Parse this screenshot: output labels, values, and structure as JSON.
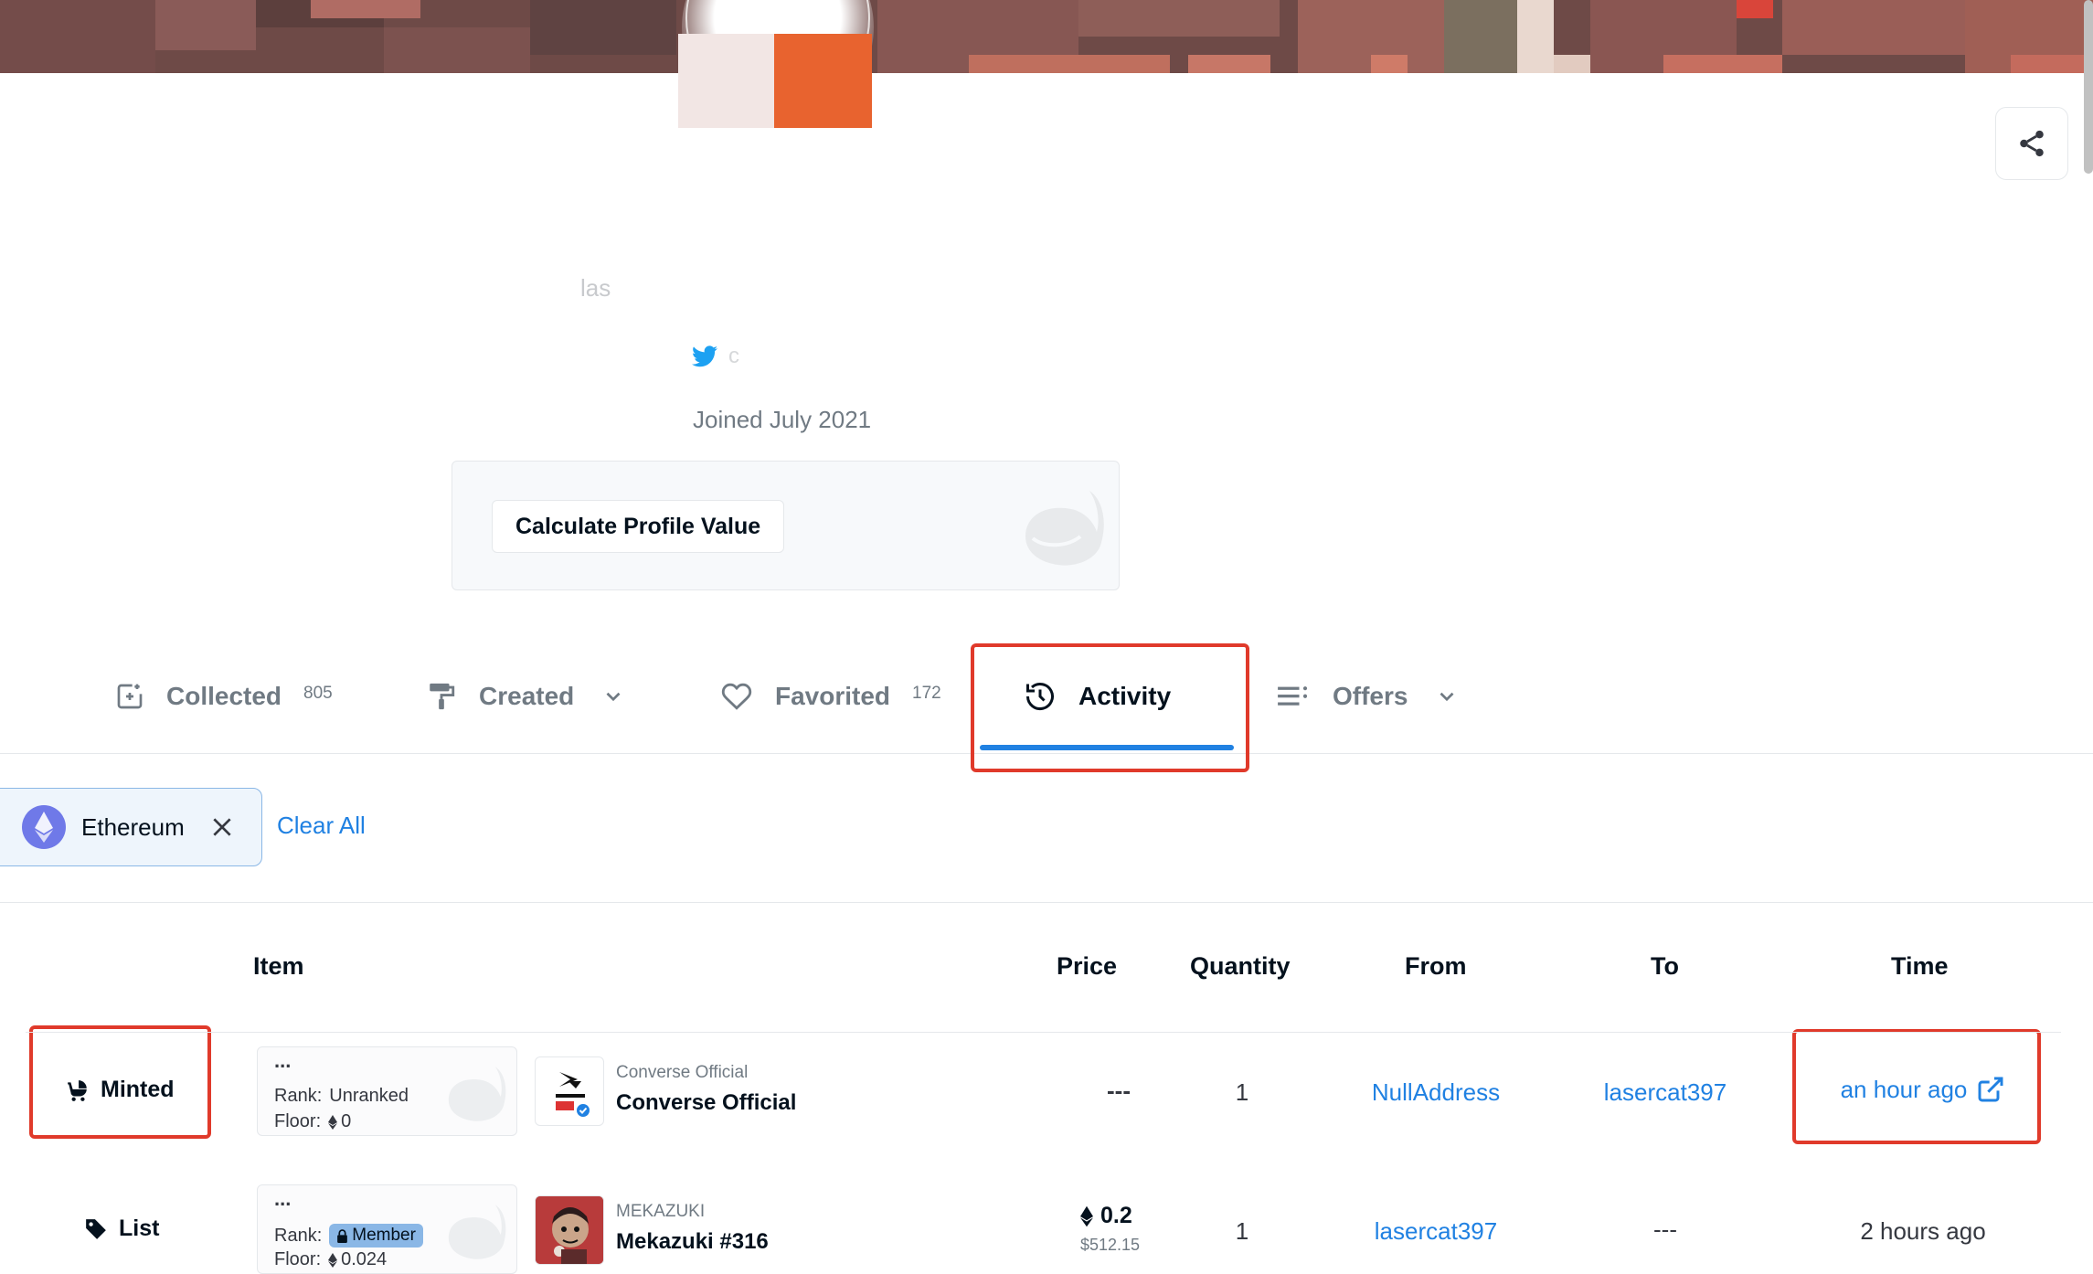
{
  "profile": {
    "username_partial": "las",
    "twitter_handle_partial": "c",
    "joined": "Joined July 2021",
    "calculate_button": "Calculate Profile Value"
  },
  "tabs": [
    {
      "label": "Collected",
      "count": "805",
      "icon": "collected-icon"
    },
    {
      "label": "Created",
      "count": "",
      "icon": "paint-roller-icon"
    },
    {
      "label": "Favorited",
      "count": "172",
      "icon": "heart-icon"
    },
    {
      "label": "Activity",
      "count": "",
      "icon": "history-icon",
      "active": true
    },
    {
      "label": "Offers",
      "count": "",
      "icon": "list-icon"
    }
  ],
  "filters": {
    "chips": [
      {
        "label": "Ethereum",
        "icon": "ethereum-icon"
      }
    ],
    "clear_all": "Clear All"
  },
  "table": {
    "headers": {
      "item": "Item",
      "price": "Price",
      "quantity": "Quantity",
      "from": "From",
      "to": "To",
      "time": "Time"
    },
    "rows": [
      {
        "event": "Minted",
        "event_icon": "stroller-icon",
        "rank_label": "Rank:",
        "rank_value": "Unranked",
        "floor_label": "Floor:",
        "floor_value": "0",
        "collection": "Converse Official",
        "item": "Converse Official",
        "price": "---",
        "price_usd": "",
        "quantity": "1",
        "from": "NullAddress",
        "to": "lasercat397",
        "time": "an hour ago",
        "time_is_link": true
      },
      {
        "event": "List",
        "event_icon": "tag-icon",
        "rank_label": "Rank:",
        "rank_value": "Member",
        "floor_label": "Floor:",
        "floor_value": "0.024",
        "collection": "MEKAZUKI",
        "item": "Mekazuki #316",
        "price": "0.2",
        "price_usd": "$512.15",
        "quantity": "1",
        "from": "lasercat397",
        "to": "---",
        "time": "2 hours ago",
        "time_is_link": false
      }
    ]
  },
  "dots": "..."
}
